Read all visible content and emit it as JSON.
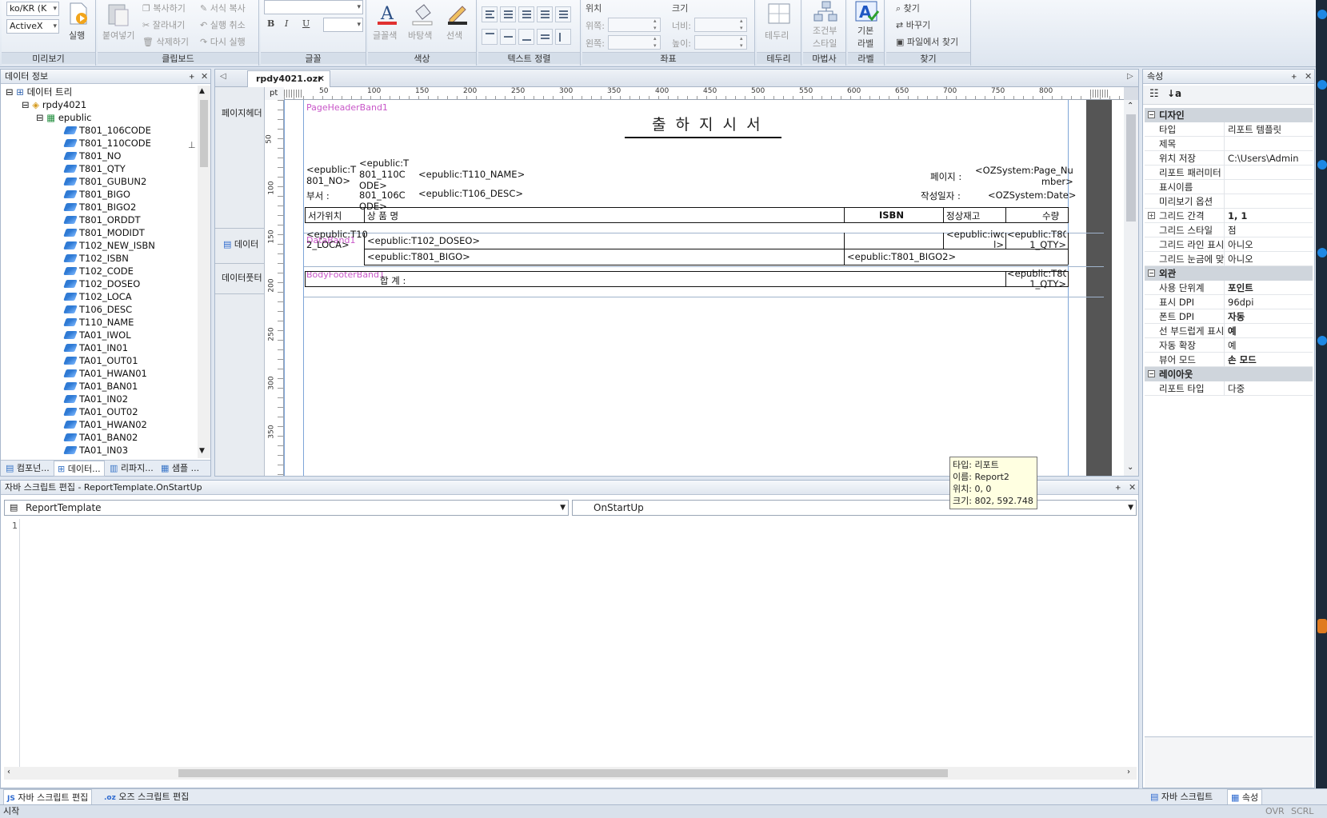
{
  "ribbon": {
    "preview": {
      "locale": "ko/KR",
      "locale_tail": "(K",
      "mode": "ActiveX",
      "run": "실행",
      "label": "미리보기"
    },
    "clipboard": {
      "paste": "붙여넣기",
      "copy": "복사하기",
      "cut": "잘라내기",
      "delete": "삭제하기",
      "format_copy": "서식 복사",
      "undo": "실행 취소",
      "redo": "다시 실행",
      "label": "클립보드"
    },
    "font": {
      "bold": "B",
      "italic": "I",
      "underline": "U",
      "label": "글꼴"
    },
    "color": {
      "font_color": "글꼴색",
      "bg_color": "바탕색",
      "line_color": "선색",
      "label": "색상"
    },
    "text_align": {
      "label": "텍스트 정렬"
    },
    "coords": {
      "position": "위치",
      "top": "위쪽:",
      "left": "왼쪽:",
      "size": "크기",
      "width": "너비:",
      "height": "높이:",
      "label": "좌표"
    },
    "border": {
      "btn": "테두리",
      "label": "테두리"
    },
    "wizard": {
      "btn1": "조건부",
      "btn2": "스타일",
      "label": "마법사"
    },
    "label_grp": {
      "btn1": "기본",
      "btn2": "라벨",
      "label": "라벨"
    },
    "find": {
      "find": "찾기",
      "replace": "바꾸기",
      "find_in_file": "파일에서 찾기",
      "label": "찾기"
    }
  },
  "data_panel": {
    "title": "데이터 정보",
    "root": "데이터 트리",
    "file": "rpdy4021",
    "schema": "epublic",
    "fields": [
      "T801_106CODE",
      "T801_110CODE",
      "T801_NO",
      "T801_QTY",
      "T801_GUBUN2",
      "T801_BIGO",
      "T801_BIGO2",
      "T801_ORDDT",
      "T801_MODIDT",
      "T102_NEW_ISBN",
      "T102_ISBN",
      "T102_CODE",
      "T102_DOSEO",
      "T102_LOCA",
      "T106_DESC",
      "T110_NAME",
      "TA01_IWOL",
      "TA01_IN01",
      "TA01_OUT01",
      "TA01_HWAN01",
      "TA01_BAN01",
      "TA01_IN02",
      "TA01_OUT02",
      "TA01_HWAN02",
      "TA01_BAN02",
      "TA01_IN03"
    ],
    "tabs": [
      "컴포넌...",
      "데이터...",
      "리파지...",
      "샘플 ..."
    ]
  },
  "editor": {
    "tab": "rpdy4021.ozr",
    "unit": "pt",
    "ruler_h": [
      "50",
      "100",
      "150",
      "200",
      "250",
      "300",
      "350",
      "400",
      "450",
      "500",
      "550",
      "600",
      "650",
      "700",
      "750",
      "800"
    ],
    "ruler_v": [
      "50",
      "100",
      "150",
      "200",
      "250",
      "300",
      "350"
    ],
    "band_labels": [
      "페이지헤더",
      "데이터",
      "데이터풋터"
    ],
    "band_names": [
      "PageHeaderBand1",
      "DataBand1",
      "BodyFooterBand1"
    ],
    "title": "출 하 지 시 서",
    "hdr": {
      "t801no": "<epublic:T801_NO>",
      "t801no_b": "801_NO>",
      "t110c_a": "<epublic:T",
      "t110c_b": "801_110C",
      "t110c_c": "ODE>",
      "busu": "부서 :",
      "t106c_b": "801_106C",
      "t106c_c": "ODE>",
      "t110name": "<epublic:T110_NAME>",
      "t106desc": "<epublic:T106_DESC>",
      "page_lbl": "페이지 :",
      "page_val_a": "<OZSystem:Page_Nu",
      "page_val_b": "mber>",
      "date_lbl": "작성일자 :",
      "date_val": "<OZSystem:Date>",
      "t801no_a": "<epublic:T"
    },
    "cols": [
      "서가위치",
      "상 품 명",
      "ISBN",
      "정상재고",
      "수량"
    ],
    "data": {
      "loca_a": "<epublic:T10",
      "loca_b": "2_LOCA>",
      "doseo": "<epublic:T102_DOSEO>",
      "iwol_a": "<epublic:iwo",
      "iwol_b": "l>",
      "qty_a": "<epublic:T80",
      "qty_b": "1_QTY>",
      "bigo": "<epublic:T801_BIGO>",
      "bigo2": "<epublic:T801_BIGO2>"
    },
    "footer": {
      "sum": "합 계 :",
      "qty_a": "<epublic:T80",
      "qty_b": "1_QTY>"
    },
    "tooltip": {
      "type": "타입: 리포트",
      "name": "이름: Report2",
      "pos": "위치: 0, 0",
      "size": "크기: 802, 592.748"
    }
  },
  "props": {
    "title": "속성",
    "cat_design": "디자인",
    "cat_look": "외관",
    "cat_layout": "레이아웃",
    "rows": [
      {
        "k": "타입",
        "v": "리포트 템플릿"
      },
      {
        "k": "제목",
        "v": ""
      },
      {
        "k": "위치 저장",
        "v": "C:\\Users\\Admin"
      },
      {
        "k": "리포트 패러미터",
        "v": ""
      },
      {
        "k": "표시이름",
        "v": ""
      },
      {
        "k": "미리보기 옵션",
        "v": ""
      },
      {
        "k": "그리드 간격",
        "v": "1, 1"
      },
      {
        "k": "그리드 스타일",
        "v": "점"
      },
      {
        "k": "그리드 라인 표시",
        "v": "아니오"
      },
      {
        "k": "그리드 눈금에 맞",
        "v": "아니오"
      }
    ],
    "rows2": [
      {
        "k": "사용 단위계",
        "v": "포인트"
      },
      {
        "k": "표시 DPI",
        "v": "96dpi"
      },
      {
        "k": "폰트 DPI",
        "v": "자동"
      },
      {
        "k": "선 부드럽게 표시",
        "v": "예"
      },
      {
        "k": "자동 확장",
        "v": "예"
      },
      {
        "k": "뷰어 모드",
        "v": "손 모드"
      }
    ],
    "rows3": [
      {
        "k": "리포트 타입",
        "v": "다중"
      }
    ],
    "tabs": [
      "자바 스크립트",
      "속성"
    ]
  },
  "script": {
    "title": "자바 스크립트 편집 - ReportTemplate.OnStartUp",
    "object": "ReportTemplate",
    "event": "OnStartUp",
    "line": "1",
    "tabs": [
      "자바 스크립트 편집",
      "오즈 스크립트 편집"
    ]
  },
  "status": {
    "text": "시작",
    "ovr": "OVR",
    "scrl": "SCRL"
  }
}
